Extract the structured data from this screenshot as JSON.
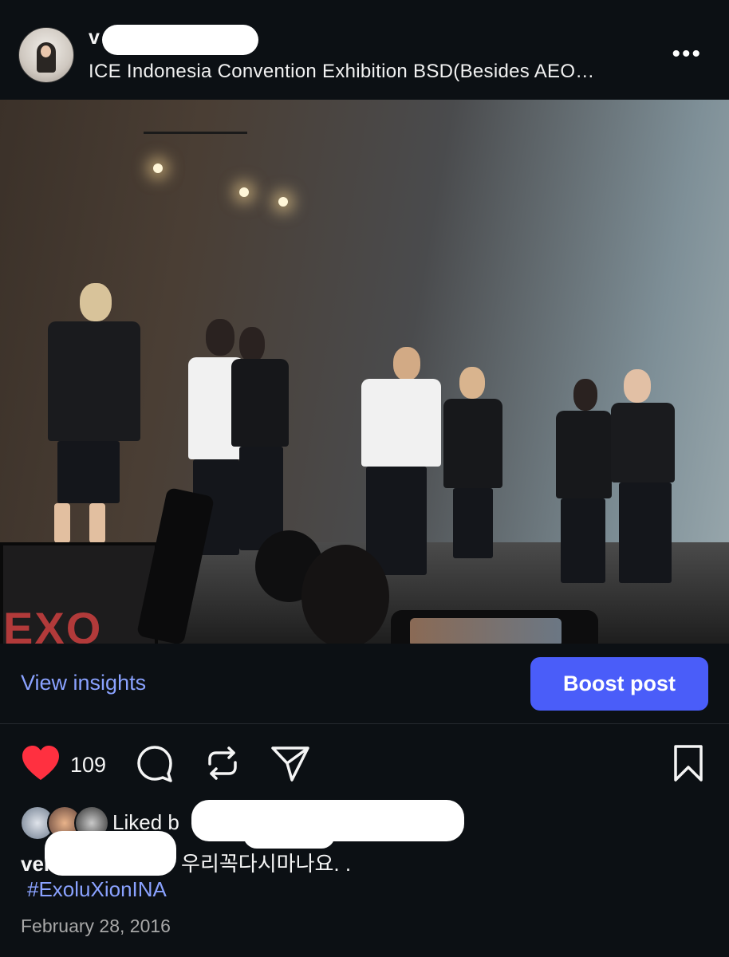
{
  "header": {
    "username": "v",
    "location": "ICE Indonesia Convention Exhibition BSD(Besides AEO…",
    "more_label": "•••"
  },
  "photo": {
    "banner_text": "EXO"
  },
  "insights": {
    "view_insights_label": "View insights",
    "boost_label": "Boost post"
  },
  "actions": {
    "like_count": "109",
    "icons": [
      "heart-icon",
      "comment-icon",
      "repost-icon",
      "share-icon",
      "bookmark-icon"
    ]
  },
  "liked_by": {
    "text": "Liked b"
  },
  "caption": {
    "username": "ver",
    "text": "우리꼭다시마나요. .",
    "hashtag": "#ExoluXionINA"
  },
  "post_date": "February 28, 2016",
  "colors": {
    "background": "#0c1014",
    "accent_link": "#8aa2ff",
    "boost_button": "#4a5df9",
    "heart": "#ff3040"
  }
}
